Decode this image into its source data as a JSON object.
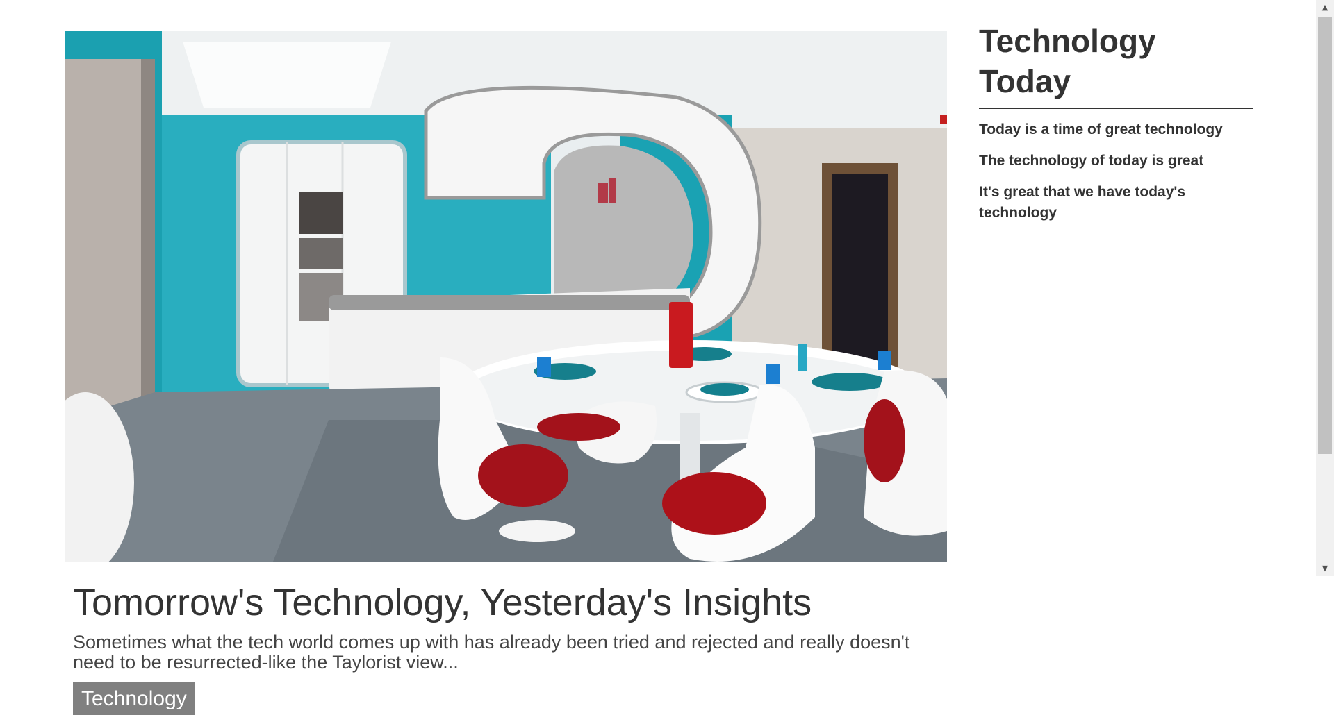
{
  "feature": {
    "headline": "Tomorrow's Technology, Yesterday's Insights",
    "excerpt": "Sometimes what the tech world comes up with has already been tried and rejected and really doesn't need to be resurrected-like the Taylorist view...",
    "category": "Technology"
  },
  "sidebar": {
    "title": "Technology Today",
    "items": [
      {
        "label": "Today is a time of great technology"
      },
      {
        "label": "The technology of today is great"
      },
      {
        "label": "It's great that we have today's technology"
      }
    ]
  },
  "colors": {
    "text": "#333333",
    "category_bg": "#808080",
    "teal_wall": "#1aa6b7",
    "chair_red": "#b5121b"
  },
  "icons": {
    "scroll_up": "scroll-up-arrow-icon",
    "scroll_down": "scroll-down-arrow-icon"
  }
}
